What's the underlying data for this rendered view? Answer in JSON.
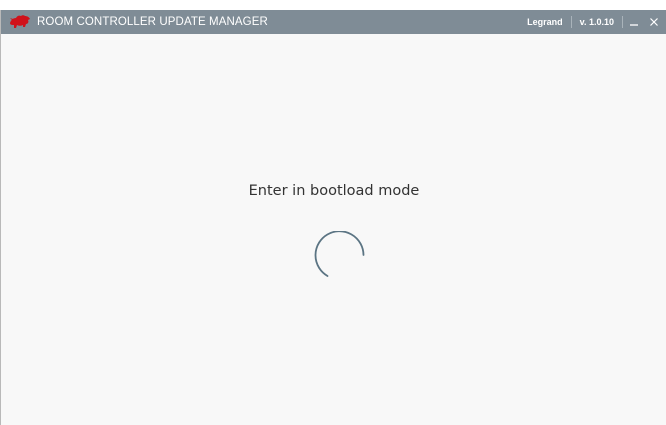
{
  "window": {
    "title": "ROOM CONTROLLER UPDATE MANAGER",
    "vendor": "Legrand",
    "version": "v. 1.0.10",
    "logo_icon": "red-bull-logo-icon",
    "minimize_icon": "minimize-icon",
    "close_icon": "close-icon",
    "titlebar_color": "#7f8c96"
  },
  "main": {
    "status_message": "Enter in bootload mode",
    "spinner_icon": "loading-spinner-icon",
    "spinner_color": "#5b7483"
  }
}
